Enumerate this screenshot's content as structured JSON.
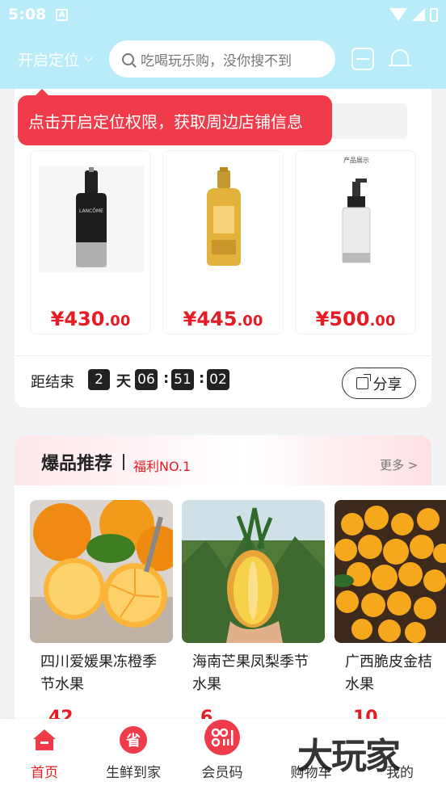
{
  "status_bar": {
    "time": "5:08"
  },
  "header": {
    "location_label": "开启定位",
    "search_placeholder": "吃喝玩乐购，没你搜不到"
  },
  "tooltip": {
    "text": "点击开启定位权限，获取周边店铺信息"
  },
  "flash_sale": {
    "products": [
      {
        "price_int": "¥430",
        "price_dec": ".00",
        "brand_text": "LANCÔME"
      },
      {
        "price_int": "¥445",
        "price_dec": ".00"
      },
      {
        "price_int": "¥500",
        "price_dec": ".00",
        "banner_text": "产品展示"
      }
    ],
    "countdown_label": "距结束",
    "days": "2",
    "days_unit": "天",
    "hours": "06",
    "minutes": "51",
    "seconds": "02",
    "sep": ":",
    "share_label": "分享"
  },
  "hot_section": {
    "title": "爆品推荐",
    "subtitle": "福利NO.1",
    "more_label": "更多 >",
    "items": [
      {
        "name": "四川爱媛果冻橙季节水果",
        "price": "42"
      },
      {
        "name": "海南芒果凤梨季节水果",
        "price": "6"
      },
      {
        "name": "广西脆皮金桔水果",
        "price": "10"
      }
    ]
  },
  "tabbar": {
    "tabs": [
      {
        "label": "首页"
      },
      {
        "label": "生鲜到家"
      },
      {
        "label": "会员码"
      },
      {
        "label": "购物车"
      },
      {
        "label": "我的"
      }
    ],
    "active_color": "#e51c23",
    "save_icon_text": "省",
    "watermark": "大玩家"
  },
  "colors": {
    "header_bg": "#b8ecf8",
    "accent": "#e51c23",
    "tooltip_bg": "#ef3b4a"
  }
}
